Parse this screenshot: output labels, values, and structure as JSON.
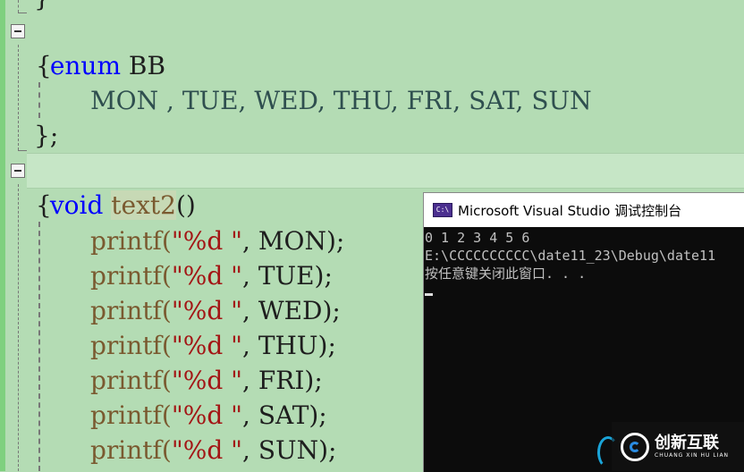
{
  "editor": {
    "lines": [
      {
        "id": "top-brace",
        "text": "}"
      },
      {
        "id": "enum-decl",
        "kw": "enum",
        "name": "BB"
      },
      {
        "id": "open-brace-1",
        "text": "{"
      },
      {
        "id": "enum-values",
        "text": "MON , TUE, WED, THU, FRI, SAT, SUN"
      },
      {
        "id": "close-brace-semicolon",
        "text": "};"
      },
      {
        "id": "func-decl",
        "kw": "void",
        "name": "text2",
        "parens": "()"
      },
      {
        "id": "open-brace-2",
        "text": "{"
      }
    ],
    "printf_lines": [
      {
        "fn": "printf(",
        "str": "\"%d \"",
        "rest": ", MON);"
      },
      {
        "fn": "printf(",
        "str": "\"%d \"",
        "rest": ", TUE);"
      },
      {
        "fn": "printf(",
        "str": "\"%d \"",
        "rest": ", WED);"
      },
      {
        "fn": "printf(",
        "str": "\"%d \"",
        "rest": ", THU);"
      },
      {
        "fn": "printf(",
        "str": "\"%d \"",
        "rest": ", FRI);"
      },
      {
        "fn": "printf(",
        "str": "\"%d \"",
        "rest": ", SAT);"
      },
      {
        "fn": "printf(",
        "str": "\"%d \"",
        "rest": ", SUN);"
      }
    ]
  },
  "console": {
    "title": "Microsoft Visual Studio 调试控制台",
    "icon_text": "C:\\",
    "output_line1": "0 1 2 3 4 5 6",
    "output_line2": "E:\\CCCCCCCCCC\\date11_23\\Debug\\date11",
    "output_line3": "按任意键关闭此窗口. . ."
  },
  "watermark": {
    "brand_cn": "创新互联",
    "brand_en": "CHUANG XIN HU LIAN"
  },
  "colors": {
    "editor_bg": "#b4dcb4",
    "keyword": "#0000ff",
    "function": "#7a5a30",
    "string": "#a31515",
    "console_bg": "#0c0c0c"
  }
}
